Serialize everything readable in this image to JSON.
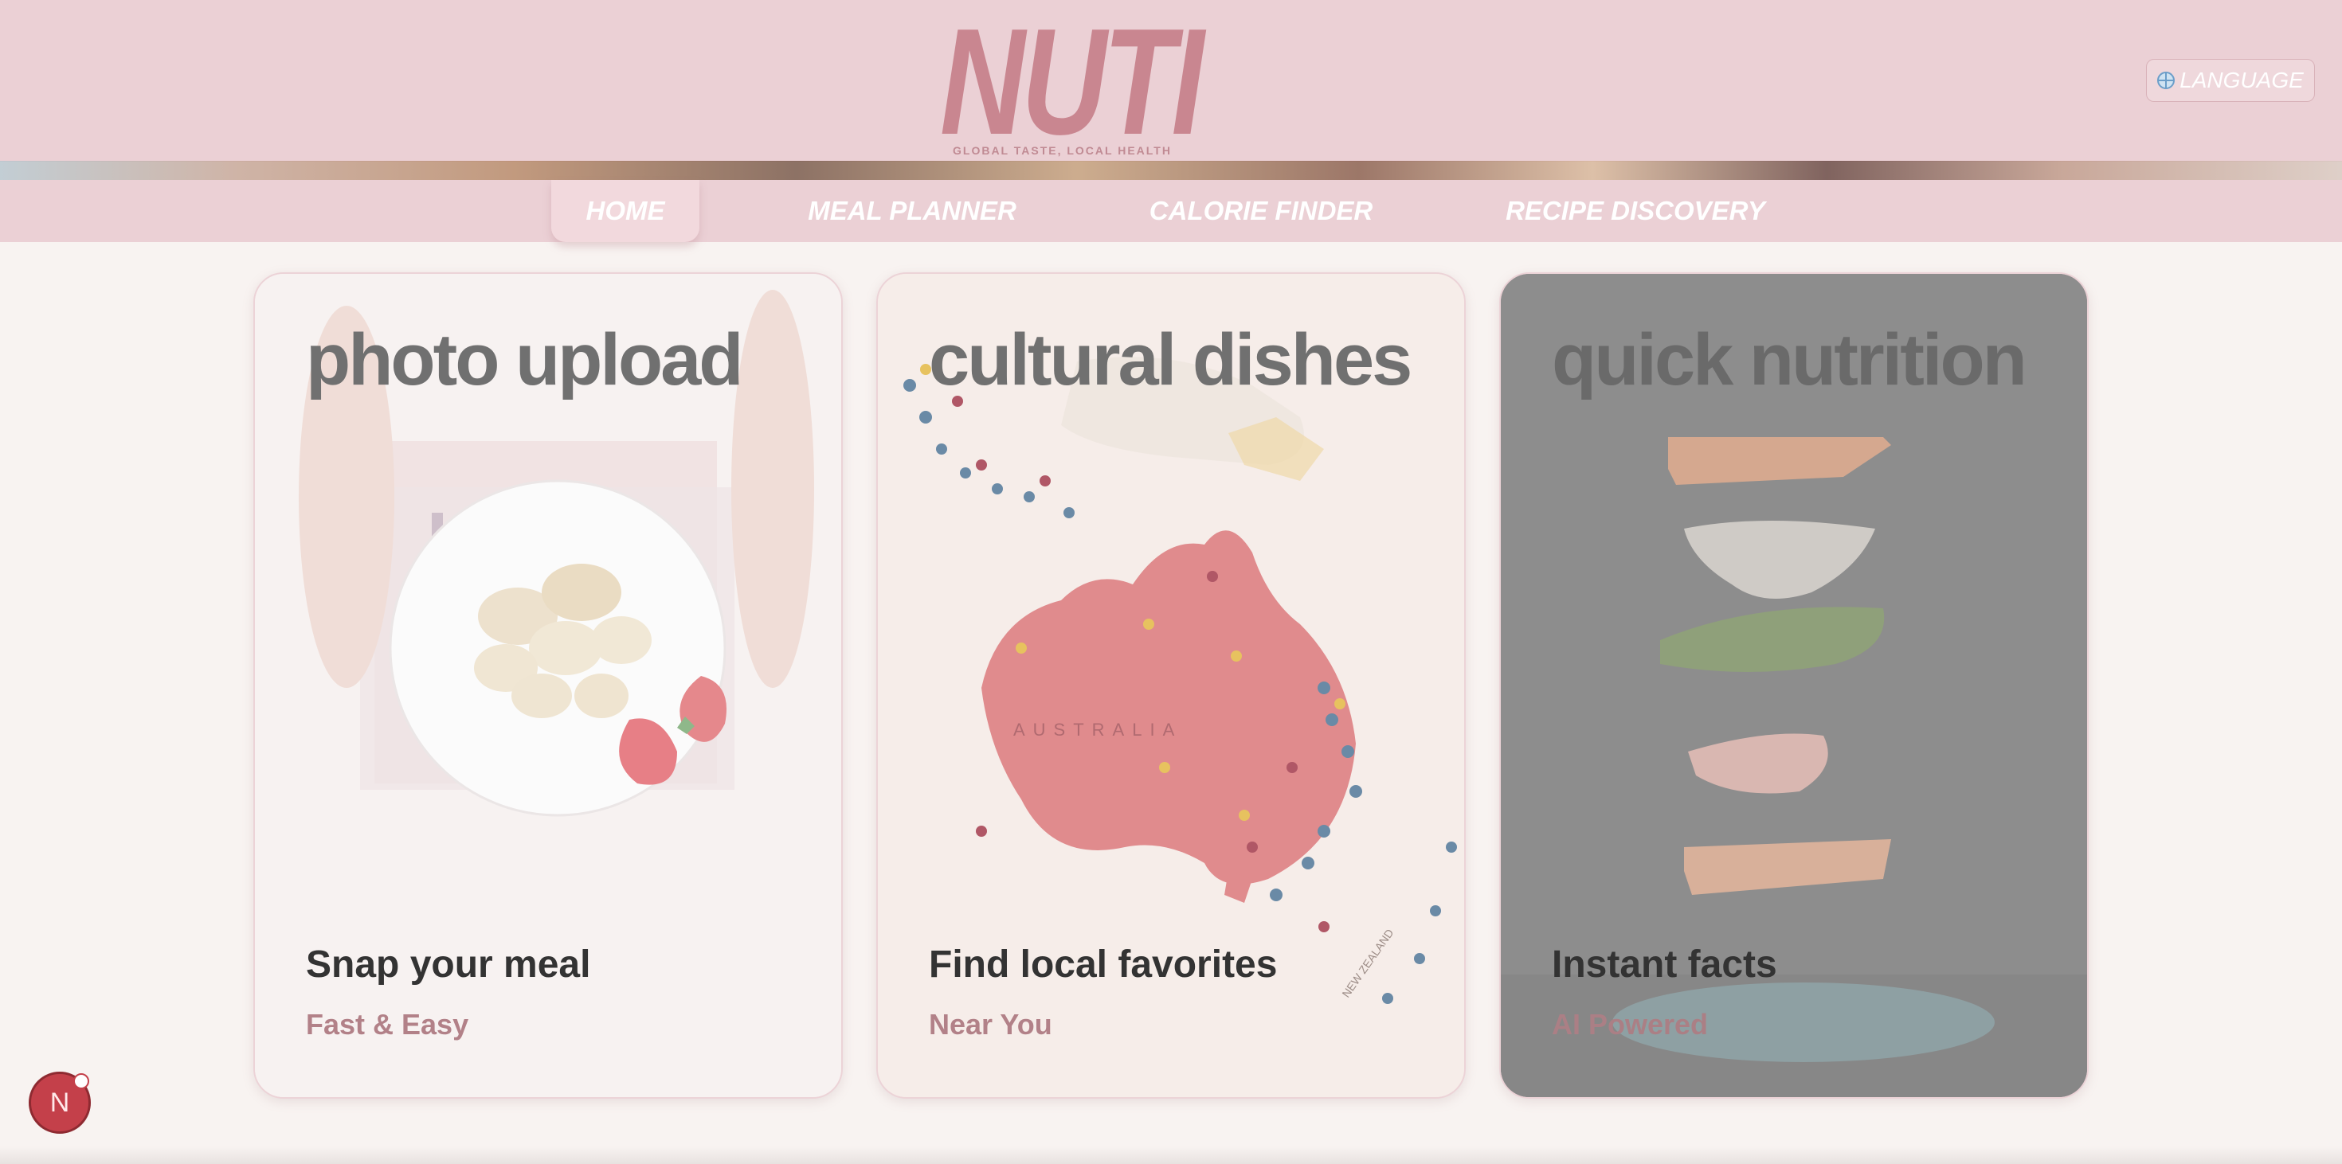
{
  "header": {
    "logo": "NUTI",
    "tagline": "GLOBAL TASTE, LOCAL HEALTH",
    "language_label": "LANGUAGE",
    "language_icon": "globe-icon"
  },
  "nav": {
    "items": [
      {
        "label": "HOME",
        "active": true
      },
      {
        "label": "MEAL PLANNER",
        "active": false
      },
      {
        "label": "CALORIE FINDER",
        "active": false
      },
      {
        "label": "RECIPE DISCOVERY",
        "active": false
      }
    ]
  },
  "cards": [
    {
      "title": "photo upload",
      "subtitle": "Snap your meal",
      "tag": "Fast & Easy",
      "image": "hands-holding-plate-bananas-strawberries"
    },
    {
      "title": "cultural dishes",
      "subtitle": "Find local favorites",
      "tag": "Near You",
      "image": "australia-map-with-pins",
      "map_label": "AUSTRALIA",
      "map_label_2": "NEW ZEALAND"
    },
    {
      "title": "quick nutrition",
      "subtitle": "Instant facts",
      "tag": "AI Powered",
      "image": "floating-sandwich-layers"
    }
  ],
  "floating_badge": {
    "label": "N"
  },
  "colors": {
    "header_bg": "#ebd0d5",
    "accent": "#c98690",
    "page_bg": "#f8f3f1",
    "tag_color": "#b28188",
    "badge": "#c4404a"
  }
}
